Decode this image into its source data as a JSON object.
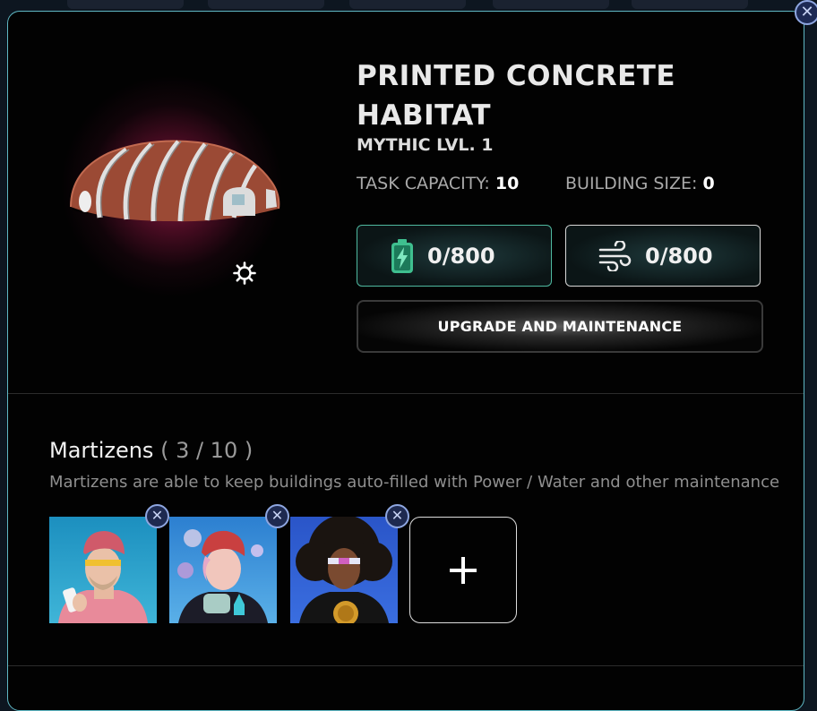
{
  "building": {
    "title": "PRINTED CONCRETE HABITAT",
    "rarity": "MYTHIC LVL. 1",
    "task_capacity_label": "TASK CAPACITY:",
    "task_capacity_value": "10",
    "building_size_label": "BUILDING SIZE:",
    "building_size_value": "0"
  },
  "resources": {
    "power": {
      "icon": "battery-icon",
      "value": "0/800"
    },
    "wind": {
      "icon": "wind-icon",
      "value": "0/800"
    }
  },
  "actions": {
    "upgrade_label": "UPGRADE AND MAINTENANCE",
    "close_icon": "close-icon",
    "settings_icon": "gear-icon"
  },
  "martizens": {
    "title": "Martizens",
    "count": "( 3 / 10 )",
    "description": "Martizens are able to keep buildings auto-filled with Power / Water and other maintenance",
    "slots": [
      {
        "name": "martizen-1",
        "remove_label": "✕"
      },
      {
        "name": "martizen-2",
        "remove_label": "✕"
      },
      {
        "name": "martizen-3",
        "remove_label": "✕"
      }
    ],
    "add_icon": "plus-icon"
  },
  "colors": {
    "accent_border": "#5fb8c4",
    "power_border": "#4fb9a0",
    "glow": "#aa1e50"
  }
}
